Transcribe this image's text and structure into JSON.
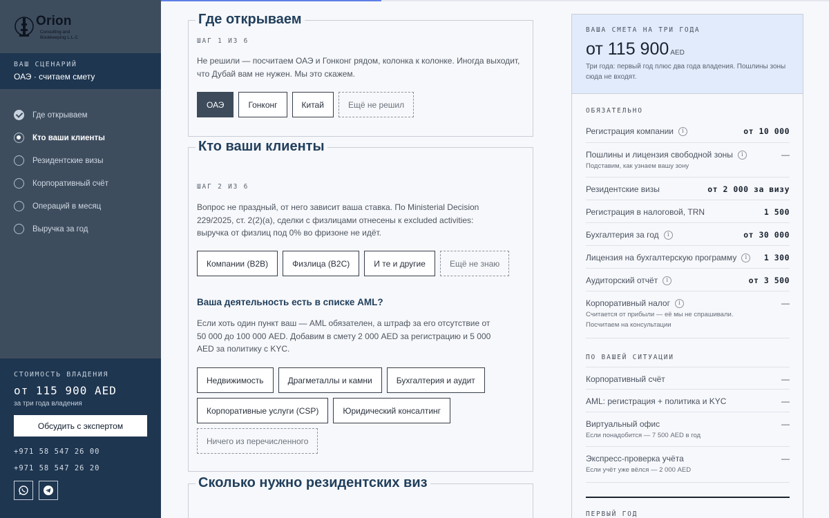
{
  "sidebar": {
    "logo_name": "Orion",
    "logo_sub": "Consulting and Bookkeeping L.L.C",
    "scenario_label": "ВАШ СЦЕНАРИЙ",
    "scenario_value": "ОАЭ · считаем смету",
    "steps": [
      {
        "label": "Где открываем",
        "state": "done"
      },
      {
        "label": "Кто ваши клиенты",
        "state": "current"
      },
      {
        "label": "Резидентские визы",
        "state": "todo"
      },
      {
        "label": "Корпоративный счёт",
        "state": "todo"
      },
      {
        "label": "Операций в месяц",
        "state": "todo"
      },
      {
        "label": "Выручка за год",
        "state": "todo"
      }
    ],
    "cost_label": "СТОИМОСТЬ ВЛАДЕНИЯ",
    "cost_value": "от 115 900 AED",
    "cost_note": "за три года владения",
    "expert_button": "Обсудить с экспертом",
    "phones": [
      "+971 58 547 26 00",
      "+971 58 547 26 20"
    ],
    "socials": [
      "whatsapp-icon",
      "telegram-icon"
    ]
  },
  "progress_fraction": 0.33,
  "step1": {
    "title": "Где открываем",
    "step_count": "ШАГ 1 ИЗ 6",
    "text": "Не решили — посчитаем ОАЭ и Гонконг рядом, колонка к колонке. Иногда выходит, что Дубай вам не нужен. Мы это скажем.",
    "options": [
      {
        "label": "ОАЭ",
        "style": "selected"
      },
      {
        "label": "Гонконг",
        "style": "normal"
      },
      {
        "label": "Китай",
        "style": "normal"
      },
      {
        "label": "Ещё не решил",
        "style": "dashed"
      }
    ]
  },
  "step2": {
    "title": "Кто ваши клиенты",
    "step_count": "ШАГ 2 ИЗ 6",
    "text": "Вопрос не праздный, от него зависит ваша ставка. По Ministerial Decision 229/2025, ст. 2(2)(a), сделки с физлицами отнесены к excluded activities: выручка от физлиц под 0% во фризоне не идёт.",
    "options": [
      {
        "label": "Компании (B2B)",
        "style": "normal"
      },
      {
        "label": "Физлица (B2C)",
        "style": "normal"
      },
      {
        "label": "И те и другие",
        "style": "normal"
      },
      {
        "label": "Ещё не знаю",
        "style": "dashed"
      }
    ],
    "aml_title": "Ваша деятельность есть в списке AML?",
    "aml_text": "Если хоть один пункт ваш — AML обязателен, а штраф за его отсутствие от 50 000 до 100 000 AED. Добавим в смету 2 000 AED за регистрацию и 5 000 AED за политику с KYC.",
    "aml_options_row1": [
      {
        "label": "Недвижимость",
        "style": "normal"
      },
      {
        "label": "Драгметаллы и камни",
        "style": "normal"
      },
      {
        "label": "Бухгалтерия и аудит",
        "style": "normal"
      }
    ],
    "aml_options_row2": [
      {
        "label": "Корпоративные услуги (CSP)",
        "style": "normal"
      },
      {
        "label": "Юридический консалтинг",
        "style": "normal"
      }
    ],
    "aml_none": "Ничего из перечисленного"
  },
  "step3": {
    "title": "Сколько нужно резидентских виз"
  },
  "estimate": {
    "label": "ВАША СМЕТА НА ТРИ ГОДА",
    "total": "от 115 900",
    "currency": "AED",
    "note": "Три года: первый год плюс два года владения. Пошлины зоны сюда не входят.",
    "required_label": "ОБЯЗАТЕЛЬНО",
    "required": [
      {
        "name": "Регистрация компании",
        "value": "от 10 000",
        "info": true,
        "sub": ""
      },
      {
        "name": "Пошлины и лицензия свободной зоны",
        "value": "—",
        "info": true,
        "sub": "Подставим, как узнаем вашу зону"
      },
      {
        "name": "Резидентские визы",
        "value": "от 2 000 за визу",
        "info": false,
        "sub": ""
      },
      {
        "name": "Регистрация в налоговой, TRN",
        "value": "1 500",
        "info": false,
        "sub": ""
      },
      {
        "name": "Бухгалтерия за год",
        "value": "от 30 000",
        "info": true,
        "sub": ""
      },
      {
        "name": "Лицензия на бухгалтерскую программу",
        "value": "1 300",
        "info": true,
        "sub": ""
      },
      {
        "name": "Аудиторский отчёт",
        "value": "от 3 500",
        "info": true,
        "sub": ""
      },
      {
        "name": "Корпоративный налог",
        "value": "—",
        "info": true,
        "sub": "Считается от прибыли — её мы не спрашивали. Посчитаем на консультации"
      }
    ],
    "situation_label": "ПО ВАШЕЙ СИТУАЦИИ",
    "situation": [
      {
        "name": "Корпоративный счёт",
        "value": "—",
        "sub": ""
      },
      {
        "name": "AML: регистрация + политика и KYC",
        "value": "—",
        "sub": ""
      },
      {
        "name": "Виртуальный офис",
        "value": "—",
        "sub": "Если понадобится — 7 500 AED в год"
      },
      {
        "name": "Экспресс-проверка учёта",
        "value": "—",
        "sub": "Если учёт уже вёлся — 2 000 AED"
      }
    ],
    "first_year_label": "ПЕРВЫЙ ГОД"
  }
}
